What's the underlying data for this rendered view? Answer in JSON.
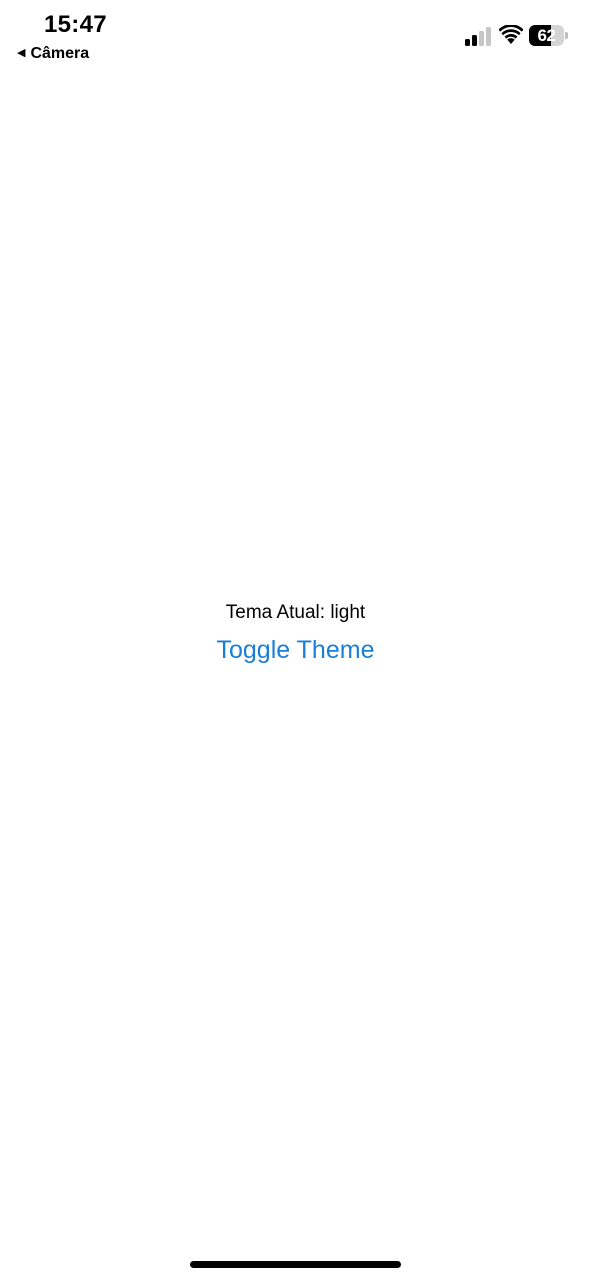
{
  "status_bar": {
    "time": "15:47",
    "back_label": "Câmera",
    "back_icon": "back-triangle-icon",
    "signal_bars_active": 2,
    "signal_bars_total": 4,
    "battery_level": "62",
    "battery_fraction": 0.62
  },
  "main": {
    "theme_label": "Tema Atual: light",
    "toggle_button_label": "Toggle Theme"
  },
  "colors": {
    "accent": "#1a7fd6",
    "text": "#000000",
    "background": "#ffffff",
    "signal_inactive": "#c7c7c7"
  }
}
